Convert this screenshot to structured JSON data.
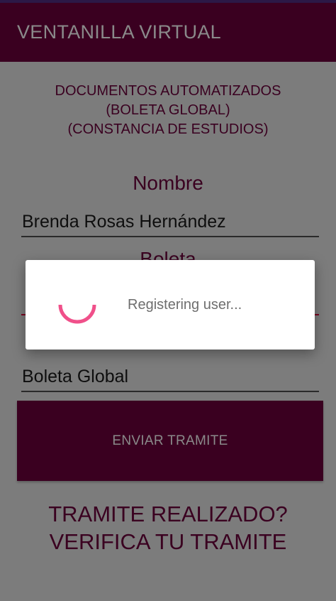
{
  "app_bar": {
    "title": "VENTANILLA VIRTUAL"
  },
  "header": {
    "lines": [
      "DOCUMENTOS AUTOMATIZADOS",
      "(BOLETA GLOBAL)",
      "(CONSTANCIA DE ESTUDIOS)"
    ]
  },
  "form": {
    "nombre_label": "Nombre",
    "nombre_value": "Brenda Rosas Hernández",
    "boleta_label": "Boleta",
    "documento_value": "Boleta Global",
    "submit_label": "ENVIAR TRAMITE"
  },
  "footer": {
    "line1": "TRAMITE REALIZADO?",
    "line2": "VERIFICA TU TRAMITE"
  },
  "dialog": {
    "message": "Registering user..."
  },
  "colors": {
    "brand": "#3a0020",
    "scrim_background": "#7c7c7c",
    "spinner": "#f0508a",
    "dialog_text": "#6e6e6e"
  }
}
